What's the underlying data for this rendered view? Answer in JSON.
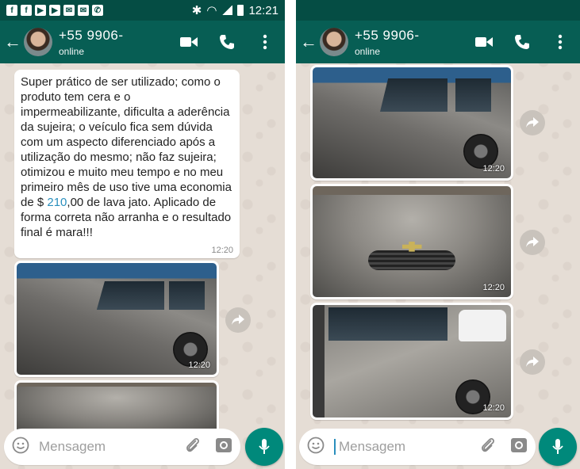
{
  "status_bar": {
    "time": "12:21"
  },
  "header": {
    "contact_name": "+55        9906-",
    "contact_status": "online"
  },
  "left": {
    "message_text_pre": "Super prático de ser utilizado; como o produto tem cera e o impermeabilizante, dificulta a aderência da sujeira; o veículo fica sem dúvida com um aspecto diferenciado após a utilização do mesmo; não faz sujeira; otimizou e muito meu tempo e no meu primeiro mês de uso tive uma economia de $ ",
    "message_text_highlight": "210",
    "message_text_post": ",00 de lava jato. Aplicado de forma correta não arranha e o resultado final é mara!!!",
    "message_time": "12:20",
    "image_time": "12:20"
  },
  "right": {
    "image_times": [
      "12:20",
      "12:20",
      "12:20"
    ]
  },
  "composer": {
    "placeholder": "Mensagem"
  },
  "colors": {
    "appbar": "#075e54",
    "statusbar": "#054d44",
    "mic": "#00897b",
    "chat_bg": "#e5ddd5",
    "link": "#2a8fbd"
  }
}
